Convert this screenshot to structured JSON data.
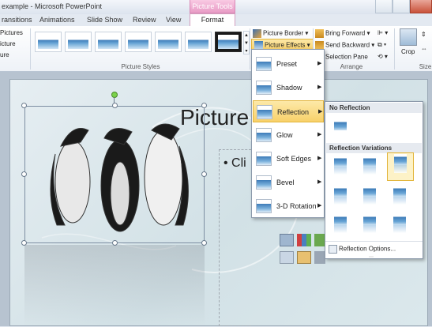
{
  "window": {
    "title": "example - Microsoft PowerPoint",
    "context_tab": "Picture Tools"
  },
  "tabs": [
    "ransitions",
    "Animations",
    "Slide Show",
    "Review",
    "View",
    "Format"
  ],
  "ribbon": {
    "left_items": [
      "Pictures",
      "icture",
      "ure"
    ],
    "picture_styles_label": "Picture Styles",
    "picture_border": "Picture Border",
    "picture_effects": "Picture Effects",
    "bring_forward": "Bring Forward",
    "send_backward": "Send Backward",
    "selection_pane": "Selection Pane",
    "arrange_label": "Arrange",
    "crop": "Crop",
    "size_label": "Size"
  },
  "effects_menu": [
    "Preset",
    "Shadow",
    "Reflection",
    "Glow",
    "Soft Edges",
    "Bevel",
    "3-D Rotation"
  ],
  "effects_menu_active": "Reflection",
  "reflection_menu": {
    "no_reflection": "No Reflection",
    "variations": "Reflection Variations",
    "options": "Reflection Options..."
  },
  "slide": {
    "title": "Picture",
    "bullet": "Cli"
  }
}
